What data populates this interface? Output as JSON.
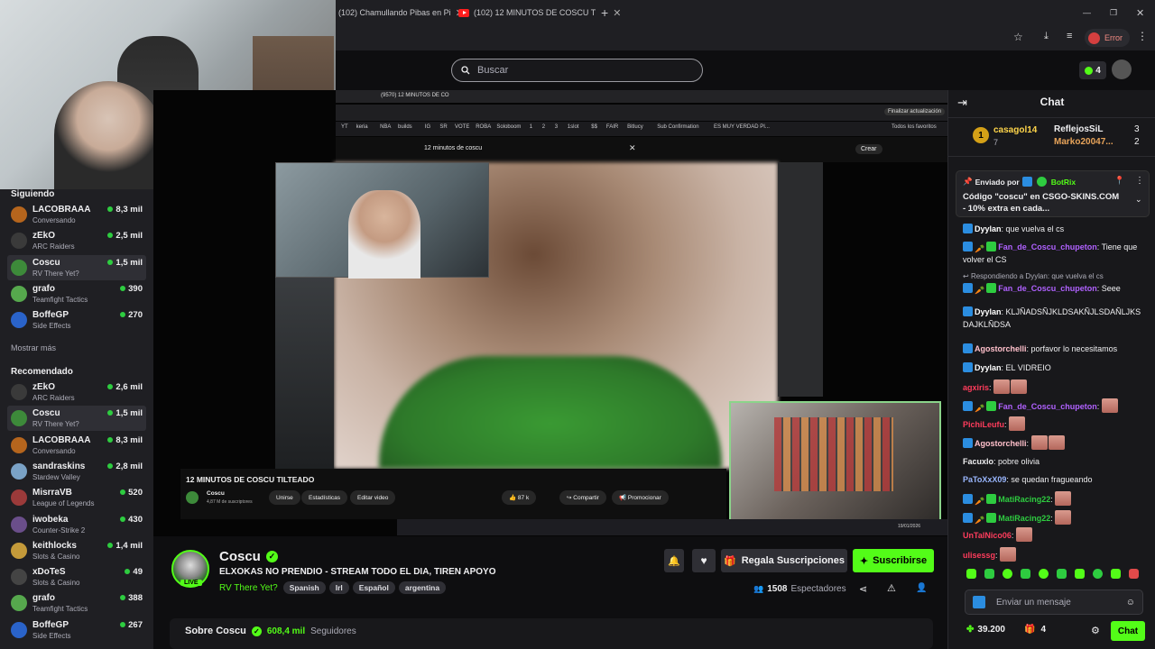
{
  "browser": {
    "tab1_title": "(102) Chamullando Pibas en Pi",
    "tab2_title": "(102) 12 MINUTOS DE COSCU T",
    "error_label": "Error"
  },
  "header": {
    "search_placeholder": "Buscar",
    "points_count": "4"
  },
  "sidebar": {
    "following_title": "Siguiendo",
    "following": [
      {
        "name": "LACOBRAAA",
        "game": "Conversando",
        "viewers": "8,3 mil",
        "color": "#b5651d"
      },
      {
        "name": "zEkO",
        "game": "ARC Raiders",
        "viewers": "2,5 mil",
        "color": "#3a3a3a"
      },
      {
        "name": "Coscu",
        "game": "RV There Yet?",
        "viewers": "1,5 mil",
        "color": "#3d8a3a"
      },
      {
        "name": "grafo",
        "game": "Teamfight Tactics",
        "viewers": "390",
        "color": "#56a84d"
      },
      {
        "name": "BoffeGP",
        "game": "Side Effects",
        "viewers": "270",
        "color": "#2a63c9"
      }
    ],
    "show_more": "Mostrar más",
    "recommended_title": "Recomendado",
    "recommended": [
      {
        "name": "zEkO",
        "game": "ARC Raiders",
        "viewers": "2,6 mil",
        "color": "#3a3a3a"
      },
      {
        "name": "Coscu",
        "game": "RV There Yet?",
        "viewers": "1,5 mil",
        "color": "#3d8a3a"
      },
      {
        "name": "LACOBRAAA",
        "game": "Conversando",
        "viewers": "8,3 mil",
        "color": "#b5651d"
      },
      {
        "name": "sandraskins",
        "game": "Stardew Valley",
        "viewers": "2,8 mil",
        "color": "#7aa2c6"
      },
      {
        "name": "MisrraVB",
        "game": "League of Legends",
        "viewers": "520",
        "color": "#9b3a3a"
      },
      {
        "name": "iwobeka",
        "game": "Counter-Strike 2",
        "viewers": "430",
        "color": "#6a4e8a"
      },
      {
        "name": "keithlocks",
        "game": "Slots & Casino",
        "viewers": "1,4 mil",
        "color": "#c49a3a"
      },
      {
        "name": "xDoTeS",
        "game": "Slots & Casino",
        "viewers": "49",
        "color": "#444"
      },
      {
        "name": "grafo",
        "game": "Teamfight Tactics",
        "viewers": "388",
        "color": "#56a84d"
      },
      {
        "name": "BoffeGP",
        "game": "Side Effects",
        "viewers": "267",
        "color": "#2a63c9"
      }
    ]
  },
  "video": {
    "inner_tab": "(9570) 12 MINUTOS DE CO",
    "inner_search": "12 minutos de coscu",
    "create_label": "Crear",
    "update_label": "Finalizar actualización",
    "bookmarks": [
      "YT",
      "keria",
      "NBA",
      "builds",
      "IG",
      "SR",
      "VOTE",
      "ROBA",
      "Soloboom",
      "1",
      "2",
      "3",
      "1slot",
      "$$",
      "FAIR",
      "Bitlucy",
      "Sub Confirmation",
      "ES MUY VERDAD PI...",
      "Todos los favoritos"
    ],
    "yt_title": "12 MINUTOS DE COSCU TILTEADO",
    "yt_channel": "Coscu",
    "yt_subs": "4,87 M de suscriptores",
    "yt_buttons": [
      "Unirse",
      "Estadísticas",
      "Editar video"
    ],
    "yt_likes": "87 k",
    "yt_share": "Compartir",
    "yt_promote": "Promocionar",
    "clock": "19/01/2026"
  },
  "stream": {
    "name": "Coscu",
    "title": "ELXOKAS NO PRENDIO - STREAM TODO EL DIA, TIREN APOYO",
    "game": "RV There Yet?",
    "tags": [
      "Spanish",
      "Irl",
      "Español",
      "argentina"
    ],
    "live_label": "LIVE",
    "gift_label": "Regala Suscripciones",
    "subscribe_label": "Suscribirse",
    "viewers": "1508",
    "viewers_label": "Espectadores",
    "about_label": "Sobre Coscu",
    "followers": "608,4 mil",
    "followers_label": "Seguidores"
  },
  "chat": {
    "title": "Chat",
    "top1_name": "casagol14",
    "top1_count": "7",
    "top2_name": "ReflejosSiL",
    "top2_count": "3",
    "top3_name": "Marko20047...",
    "top3_count": "2",
    "pinned_by": "Enviado por",
    "pinned_user": "BotRix",
    "pinned_text": "Código \"coscu\" en CSGO-SKINS.COM - 10% extra en cada...",
    "messages": [
      {
        "user": "Dyylan",
        "color": "#ffffff",
        "text": "que vuelva el cs"
      },
      {
        "user": "Fan_de_Coscu_chupeton",
        "color": "#b061ff",
        "text": "Tiene que volver el CS"
      },
      {
        "reply": "Respondiendo a Dyylan: que vuelva el cs"
      },
      {
        "user": "Fan_de_Coscu_chupeton",
        "color": "#b061ff",
        "text": "Seee"
      },
      {
        "user": "Dyylan",
        "color": "#ffffff",
        "text": "KLJÑADSÑJKLDSAKÑJLSDAÑLJKSDAJKLÑDSA"
      },
      {
        "user": "Agostorchelli",
        "color": "#ffc0cb",
        "text": "porfavor lo necesitamos"
      },
      {
        "user": "Dyylan",
        "color": "#ffffff",
        "text": "EL VIDREIO"
      },
      {
        "user": "agxiris",
        "color": "#ff3c5c",
        "text": ""
      },
      {
        "user": "Fan_de_Coscu_chupeton",
        "color": "#b061ff",
        "text": ""
      },
      {
        "user": "PichiLeufu",
        "color": "#ff3c5c",
        "text": ""
      },
      {
        "user": "Agostorchelli",
        "color": "#ffc0cb",
        "text": ""
      },
      {
        "user": "Facuxlo",
        "color": "#efeff1",
        "text": "pobre olivia"
      },
      {
        "user": "PaToXxX09",
        "color": "#9ab7ff",
        "text": "se quedan fragueando"
      },
      {
        "user": "MatiRacing22",
        "color": "#2ecc40",
        "text": ""
      },
      {
        "user": "MatiRacing22",
        "color": "#2ecc40",
        "text": ""
      },
      {
        "user": "UnTalNico06",
        "color": "#ff3c5c",
        "text": ""
      },
      {
        "user": "ulisessg",
        "color": "#ff3c5c",
        "text": ""
      }
    ],
    "input_placeholder": "Enviar un mensaje",
    "points": "39.200",
    "gift_count": "4",
    "send_label": "Chat"
  },
  "colors": {
    "accent_green": "#53fc18",
    "bg_dark": "#0e0e10",
    "live_red": "#2ecc40"
  }
}
